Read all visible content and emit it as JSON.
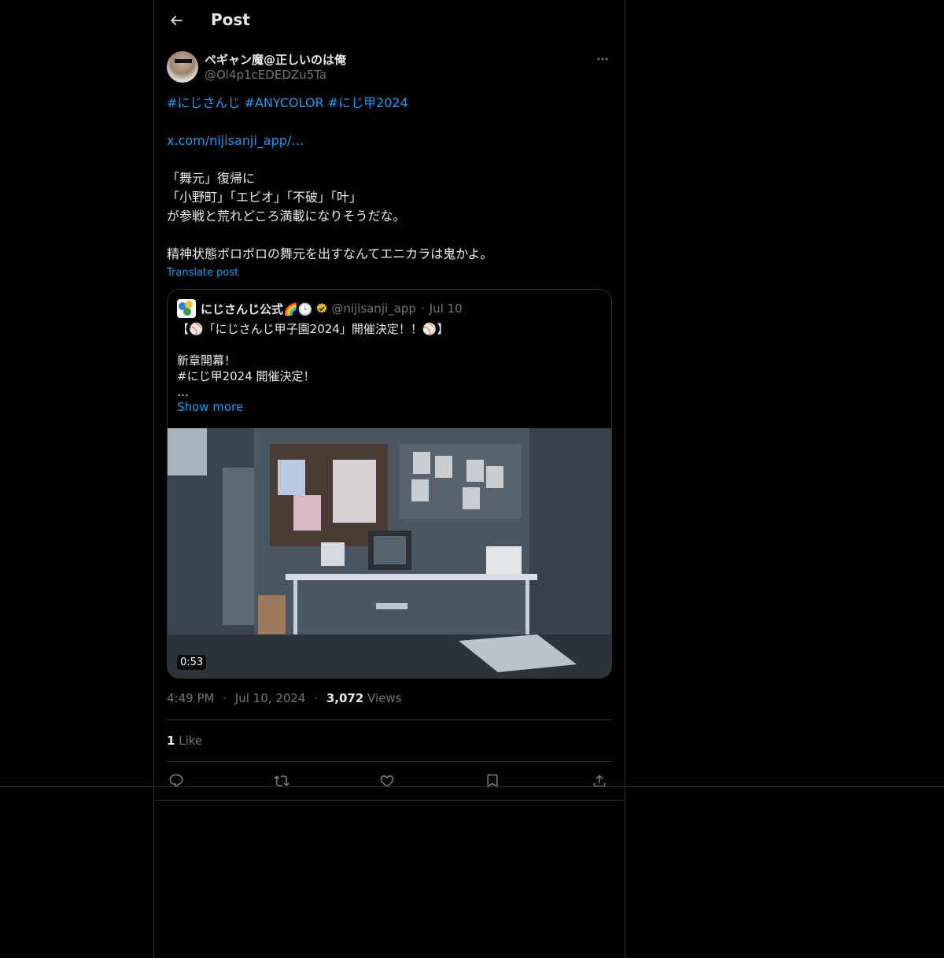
{
  "header": {
    "title": "Post"
  },
  "post": {
    "author": {
      "display_name": "ペギャン魔@正しいのは俺",
      "handle": "@Ol4p1cEDEDZu5Ta"
    },
    "hashtags": [
      "#にじさんじ",
      "#ANYCOLOR",
      "#にじ甲2024"
    ],
    "link": "x.com/nijisanji_app/…",
    "lines": [
      "「舞元」復帰に",
      "「小野町」「エビオ」「不破」「叶」",
      "が参戦と荒れどころ満載になりそうだな。",
      "精神状態ボロボロの舞元を出すなんてエニカラは鬼かよ。"
    ],
    "translate_label": "Translate post"
  },
  "quote": {
    "name": "にじさんじ公式🌈🕒",
    "handle": "@nijisanji_app",
    "separator": "·",
    "date": "Jul 10",
    "lines": [
      "【⚾「にじさんじ甲子園2024」開催決定！！⚾】",
      "新章開幕！",
      "#にじ甲2024 開催決定！",
      "…"
    ],
    "show_more": "Show more",
    "video_duration": "0:53"
  },
  "meta": {
    "time": "4:49 PM",
    "separator": "·",
    "date": "Jul 10, 2024",
    "views_count": "3,072",
    "views_label": "Views"
  },
  "likes": {
    "count": "1",
    "label": "Like"
  },
  "icons": {
    "back": "arrow-left-icon",
    "more": "more-horizontal-icon",
    "reply": "reply-icon",
    "repost": "repost-icon",
    "like": "heart-icon",
    "bookmark": "bookmark-icon",
    "share": "share-icon",
    "verified": "verified-badge-icon"
  },
  "colors": {
    "background": "#000000",
    "text": "#e7e9ea",
    "secondary": "#71767b",
    "accent": "#1d9bf0",
    "border": "#2f3336",
    "verified_gold": "#e2b719"
  }
}
